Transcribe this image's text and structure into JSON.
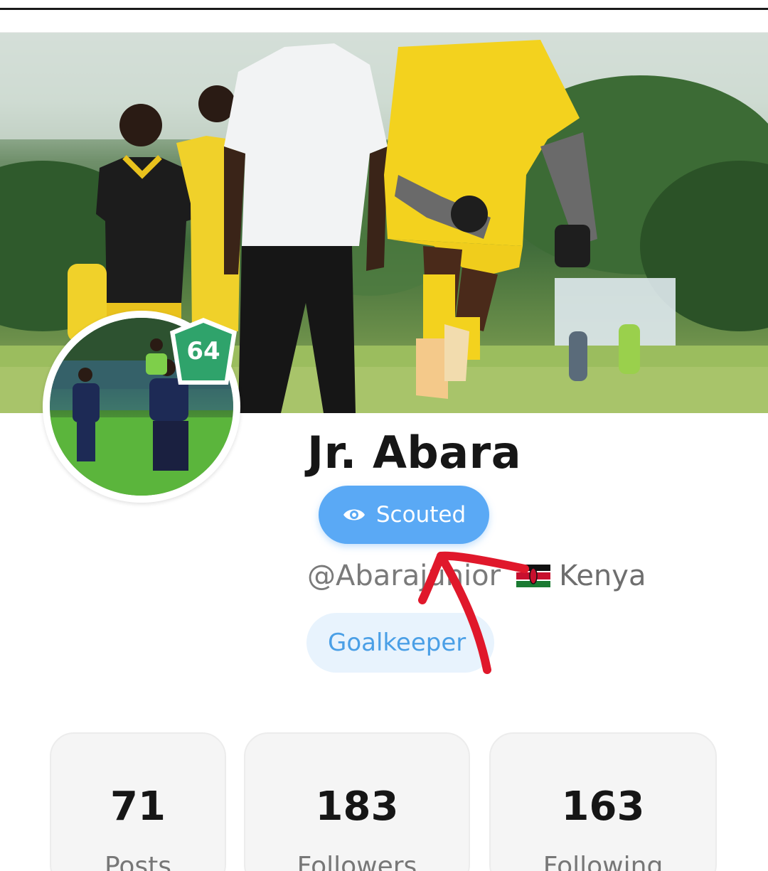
{
  "profile": {
    "name": "Jr. Abara",
    "rating": "64",
    "badge_label": "Scouted",
    "handle": "@Abarajunior",
    "country": "Kenya",
    "position": "Goalkeeper"
  },
  "stats": [
    {
      "value": "71",
      "label": "Posts"
    },
    {
      "value": "183",
      "label": "Followers"
    },
    {
      "value": "163",
      "label": "Following"
    }
  ],
  "icons": {
    "scouted": "eye-icon",
    "country_flag": "kenya-flag-icon",
    "rating_badge": "pentagon-badge-icon",
    "annotation": "red-arrow"
  },
  "colors": {
    "accent_blue": "#5aa9f5",
    "rating_green": "#2fa36b",
    "chip_bg": "#e8f3fd",
    "chip_text": "#4a9fe6",
    "annotation_red": "#e0182b"
  }
}
